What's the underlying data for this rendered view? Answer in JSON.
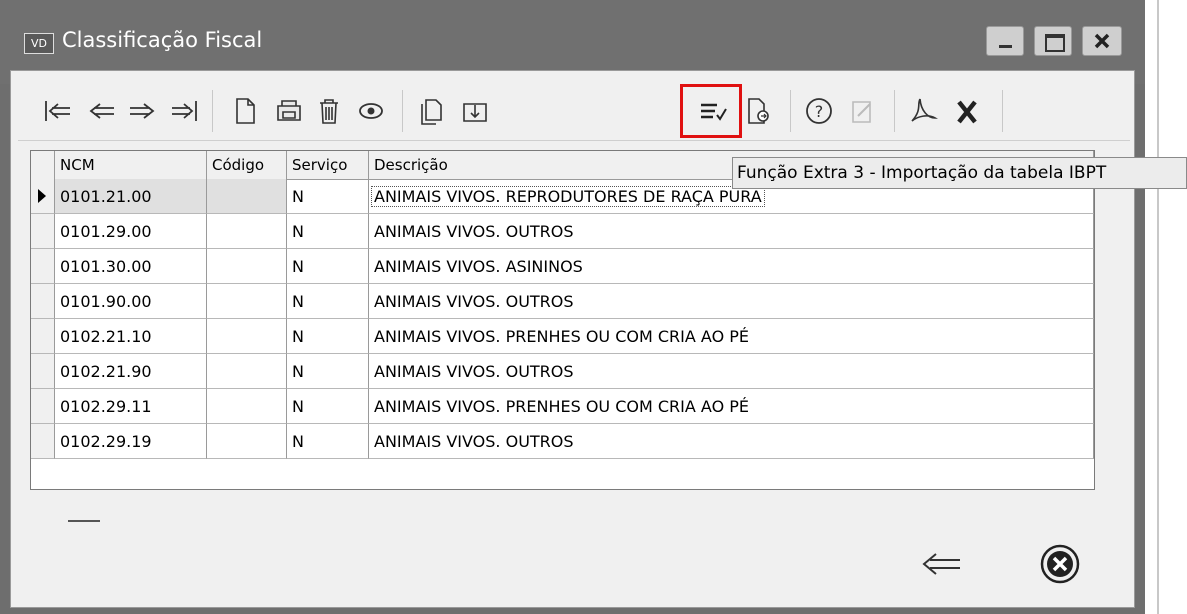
{
  "window": {
    "app_badge": "VD",
    "title": "Classificação Fiscal"
  },
  "toolbar": {
    "tooltip": "Função Extra 3 - Importação da tabela IBPT"
  },
  "grid": {
    "columns": [
      "NCM",
      "Código",
      "Serviço",
      "Descrição"
    ],
    "rows": [
      {
        "ncm": "0101.21.00",
        "codigo": "",
        "servico": "N",
        "descricao": "ANIMAIS VIVOS. REPRODUTORES DE RAÇA PURA"
      },
      {
        "ncm": "0101.29.00",
        "codigo": "",
        "servico": "N",
        "descricao": "ANIMAIS VIVOS. OUTROS"
      },
      {
        "ncm": "0101.30.00",
        "codigo": "",
        "servico": "N",
        "descricao": "ANIMAIS VIVOS. ASININOS"
      },
      {
        "ncm": "0101.90.00",
        "codigo": "",
        "servico": "N",
        "descricao": "ANIMAIS VIVOS. OUTROS"
      },
      {
        "ncm": "0102.21.10",
        "codigo": "",
        "servico": "N",
        "descricao": "ANIMAIS VIVOS. PRENHES OU COM CRIA AO PÉ"
      },
      {
        "ncm": "0102.21.90",
        "codigo": "",
        "servico": "N",
        "descricao": "ANIMAIS VIVOS. OUTROS"
      },
      {
        "ncm": "0102.29.11",
        "codigo": "",
        "servico": "N",
        "descricao": "ANIMAIS VIVOS. PRENHES OU COM CRIA AO PÉ"
      },
      {
        "ncm": "0102.29.19",
        "codigo": "",
        "servico": "N",
        "descricao": "ANIMAIS VIVOS. OUTROS"
      }
    ]
  },
  "colors": {
    "titlebar": "#707070",
    "highlight": "#e01010",
    "window_bg": "#f0f0f0"
  },
  "icons": {
    "toolbar": [
      "first-record-icon",
      "previous-record-icon",
      "next-record-icon",
      "last-record-icon",
      "new-document-icon",
      "print-icon",
      "trash-icon",
      "view-eye-icon",
      "copy-icon",
      "import-icon",
      "extra-function-icon",
      "export-icon",
      "help-icon",
      "edit-icon",
      "pdf-icon",
      "excel-icon"
    ],
    "footer": [
      "back-arrow-icon",
      "close-circle-icon"
    ]
  }
}
